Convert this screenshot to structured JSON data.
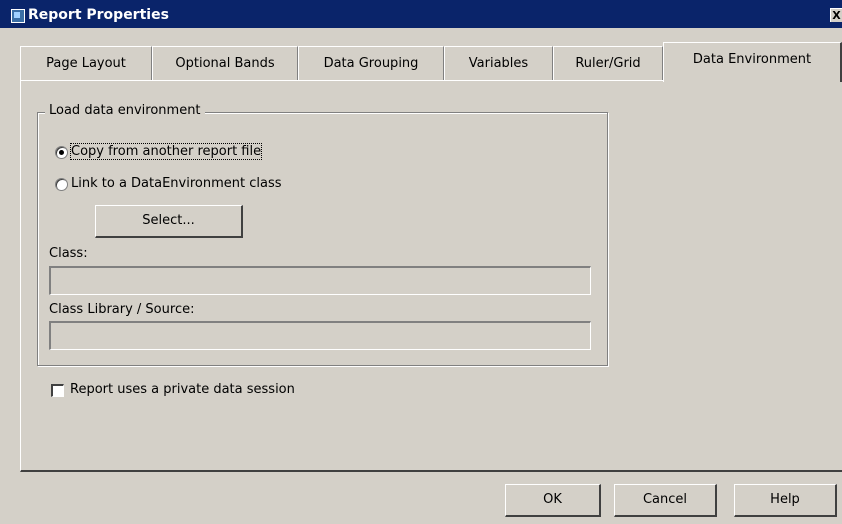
{
  "window": {
    "title": "Report Properties",
    "close_glyph": "X"
  },
  "tabs": [
    {
      "label": "Page Layout"
    },
    {
      "label": "Optional Bands"
    },
    {
      "label": "Data Grouping"
    },
    {
      "label": "Variables"
    },
    {
      "label": "Ruler/Grid"
    },
    {
      "label": "Data Environment"
    }
  ],
  "active_tab": "Data Environment",
  "data_environment": {
    "group_label": "Load data environment",
    "radio_copy": {
      "label": "Copy from another report file",
      "checked": true
    },
    "radio_link": {
      "label": "Link to a DataEnvironment class",
      "checked": false
    },
    "select_button": "Select...",
    "class_label": "Class:",
    "class_value": "",
    "class_library_label": "Class Library / Source:",
    "class_library_value": ""
  },
  "private_session": {
    "label": "Report uses a private data session",
    "checked": false
  },
  "footer": {
    "ok": "OK",
    "cancel": "Cancel",
    "help": "Help"
  }
}
